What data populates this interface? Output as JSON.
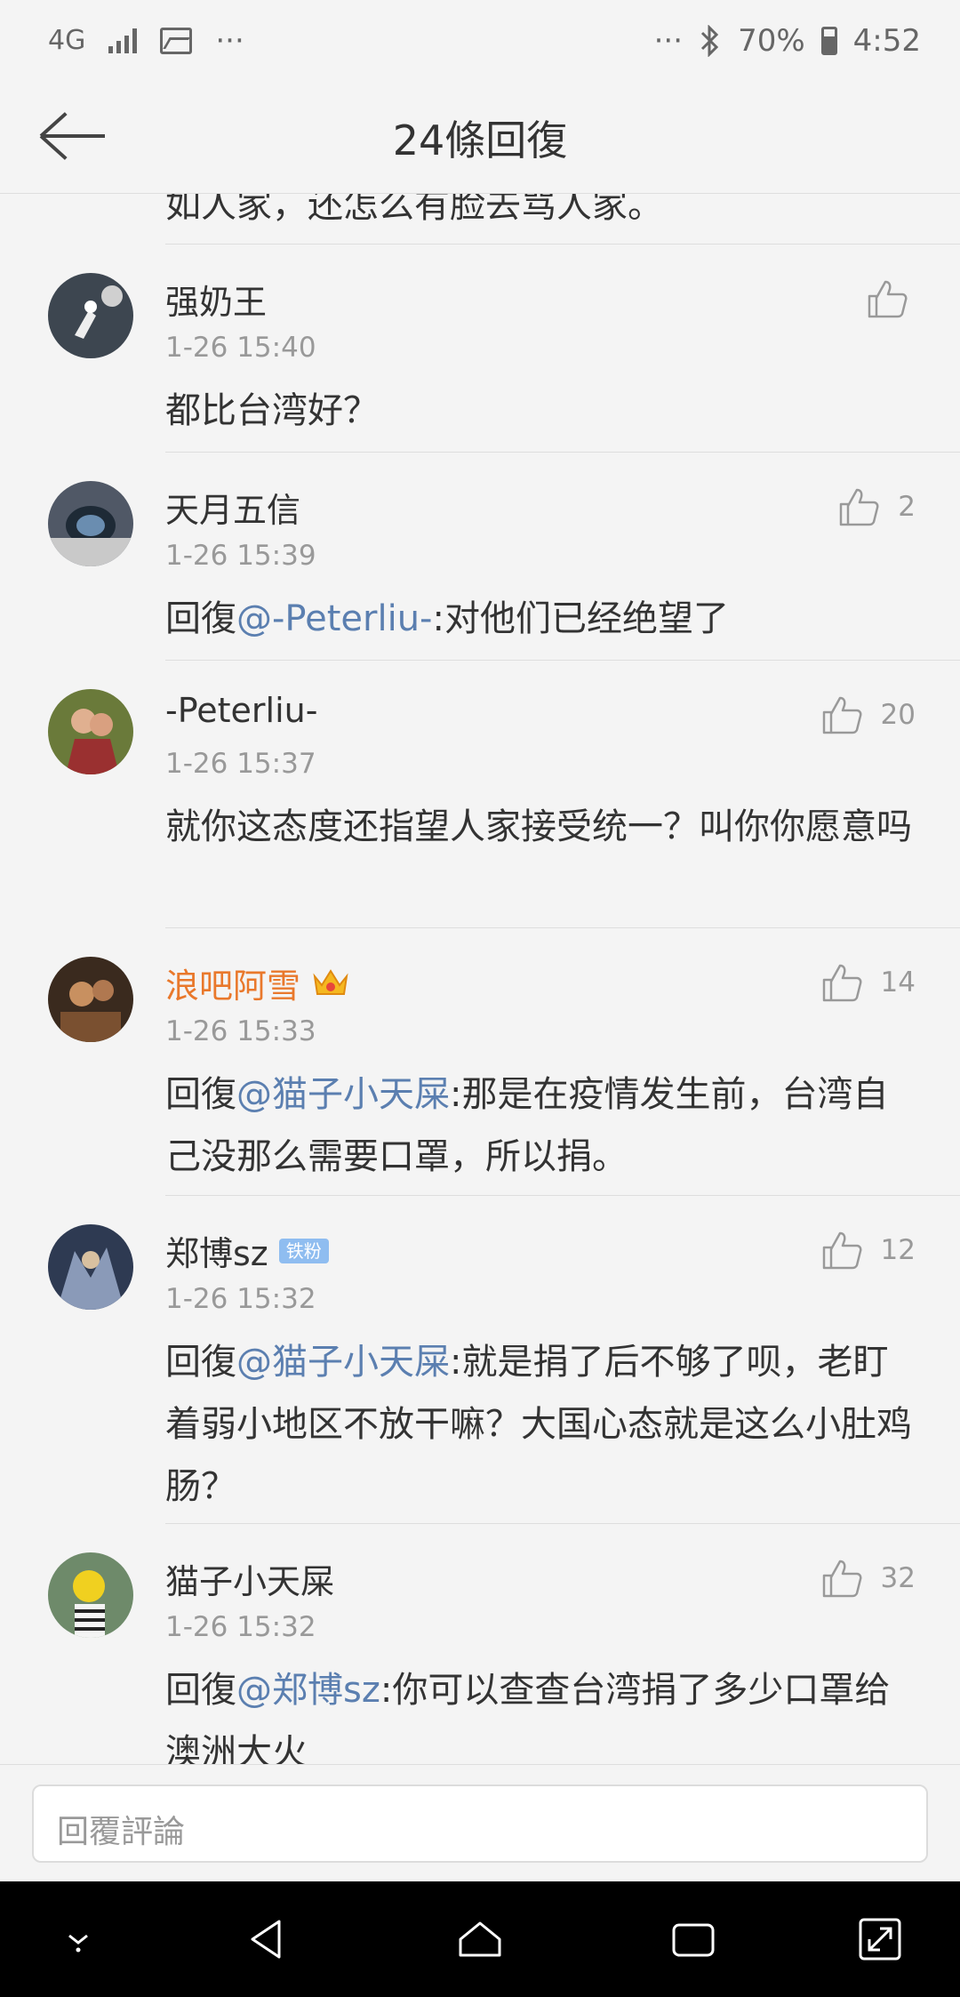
{
  "status_bar": {
    "network": "4G",
    "dots": "···",
    "battery": "70%",
    "time": "4:52"
  },
  "header": {
    "title": "24條回復"
  },
  "partial_text": "如人家，还怎么有脸去骂人家。",
  "comments": [
    {
      "name": "强奶王",
      "time": "1-26 15:40",
      "text_prefix": "",
      "mention": "",
      "text": "都比台湾好？",
      "likes": ""
    },
    {
      "name": "天月五信",
      "time": "1-26 15:39",
      "text_prefix": "回復",
      "mention": "@-Peterliu-",
      "text": ":对他们已经绝望了",
      "likes": "2"
    },
    {
      "name": "-Peterliu-",
      "time": "1-26 15:37",
      "text_prefix": "",
      "mention": "",
      "text": "就你这态度还指望人家接受统一？叫你你愿意吗",
      "likes": "20"
    },
    {
      "name": "浪吧阿雪",
      "time": "1-26 15:33",
      "text_prefix": "回復",
      "mention": "@猫子小天屎",
      "text": ":那是在疫情发生前，台湾自己没那么需要口罩，所以捐。",
      "likes": "14"
    },
    {
      "name": "郑博sz",
      "badge": "铁粉",
      "time": "1-26 15:32",
      "text_prefix": "回復",
      "mention": "@猫子小天屎",
      "text": ":就是捐了后不够了呗，老盯着弱小地区不放干嘛？大国心态就是这么小肚鸡肠？",
      "likes": "12"
    },
    {
      "name": "猫子小天屎",
      "time": "1-26 15:32",
      "text_prefix": "回復",
      "mention": "@郑博sz",
      "text": ":你可以查查台湾捐了多少口罩给澳洲大火",
      "likes": "32"
    }
  ],
  "input": {
    "placeholder": "回覆評論"
  },
  "colors": {
    "mention": "#5b7fb0",
    "vip_name": "#e9782b",
    "badge": "#8fbdf0"
  }
}
